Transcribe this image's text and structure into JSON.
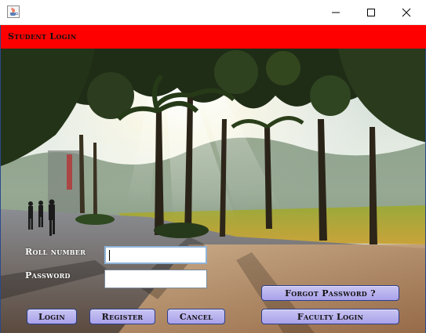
{
  "window": {
    "title": "",
    "app_icon": "java-cup-icon",
    "controls": [
      "minimize-icon",
      "maximize-icon",
      "close-icon"
    ]
  },
  "header": {
    "title": "Student Login",
    "background_color": "#ff0000"
  },
  "form": {
    "roll_label": "Roll number",
    "roll_value": "",
    "password_label": "Password",
    "password_value": ""
  },
  "buttons": {
    "login": "Login",
    "register": "Register",
    "cancel": "Cancel",
    "forgot_password": "Forgot Password ?",
    "faculty_login": "Faculty Login"
  },
  "colors": {
    "button_fill": "#b8b2ef",
    "button_border": "#2c3e8a"
  }
}
